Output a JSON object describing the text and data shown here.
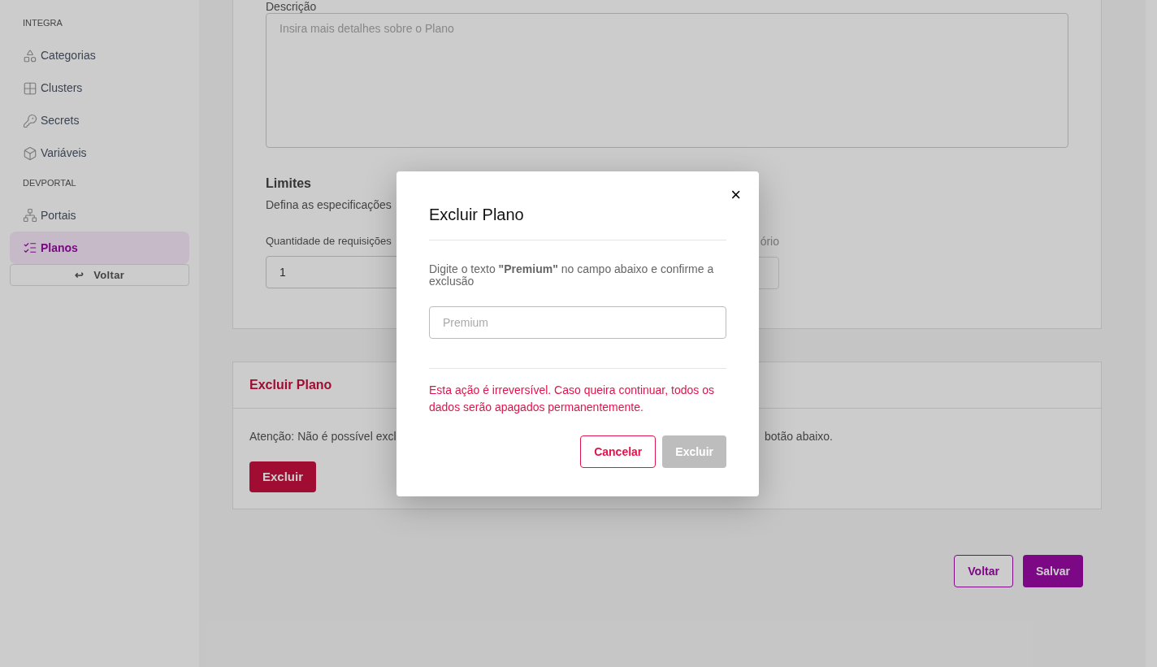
{
  "sidebar": {
    "sections": [
      {
        "title": "INTEGRA",
        "items": [
          {
            "label": "Categorias",
            "selected": false
          },
          {
            "label": "Clusters",
            "selected": false
          },
          {
            "label": "Secrets",
            "selected": false
          },
          {
            "label": "Variáveis",
            "selected": false
          }
        ]
      },
      {
        "title": "DEVPORTAL",
        "items": [
          {
            "label": "Portais",
            "selected": false
          },
          {
            "label": "Planos",
            "selected": true
          }
        ]
      }
    ],
    "back_button": {
      "icon": "↩",
      "label": "Voltar"
    }
  },
  "form": {
    "description_label": "Descrição",
    "description_placeholder": "Insira mais detalhes sobre o Plano",
    "limits_title": "Limites",
    "limits_subtitle": "Defina as especificações",
    "fields": [
      {
        "label": "Quantidade de requisições",
        "value": "1"
      },
      {
        "label": "ório"
      }
    ]
  },
  "delete_card": {
    "title": "Excluir Plano",
    "text_left": "Atenção: Não é possível excl",
    "text_right": "botão abaixo.",
    "button": "Excluir"
  },
  "footer_buttons": [
    {
      "label": "Voltar",
      "kind": "outline"
    },
    {
      "label": "Salvar",
      "kind": "primary"
    }
  ],
  "modal": {
    "title": "Excluir Plano",
    "close": "×",
    "instruction": "Digite o texto **\"Premium\"** no campo abaixo e confirme a exclusão",
    "input_placeholder": "Premium",
    "warning": "Esta ação é irreversível. Caso queira continuar, todos os dados serão apagados permanentemente.",
    "buttons": [
      {
        "label": "Cancelar",
        "kind": "outline",
        "disabled": false
      },
      {
        "label": "Excluir",
        "kind": "danger",
        "disabled": true
      }
    ]
  }
}
